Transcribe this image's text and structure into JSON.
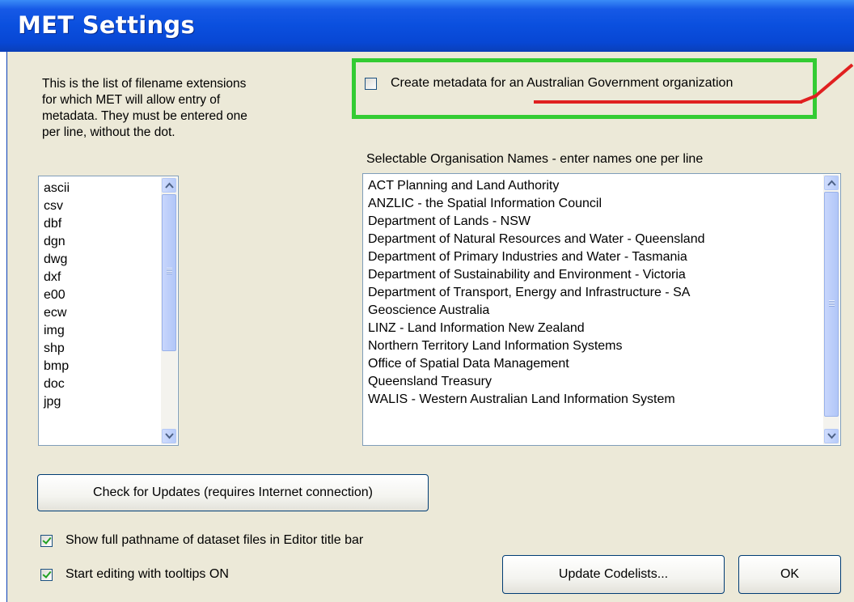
{
  "window": {
    "title": "MET Settings"
  },
  "extensions": {
    "description": "This is the list of filename extensions\nfor which MET will allow entry of\nmetadata.  They must be entered one\nper line, without the dot.",
    "items": [
      "ascii",
      "csv",
      "dbf",
      "dgn",
      "dwg",
      "dxf",
      "e00",
      "ecw",
      "img",
      "shp",
      "bmp",
      "doc",
      "jpg"
    ]
  },
  "australian_gov": {
    "label": "Create metadata for an Australian Government organization",
    "checked": false
  },
  "organisations": {
    "label": "Selectable Organisation Names - enter names one per line",
    "items": [
      "ACT Planning and Land Authority",
      "ANZLIC - the Spatial Information Council",
      "Department of Lands - NSW",
      "Department of Natural Resources and Water - Queensland",
      "Department of Primary Industries and Water - Tasmania",
      "Department of Sustainability and Environment - Victoria",
      "Department of Transport, Energy and Infrastructure - SA",
      "Geoscience Australia",
      "LINZ - Land Information New Zealand",
      "Northern Territory Land Information Systems",
      "Office of Spatial Data Management",
      "Queensland Treasury",
      "WALIS - Western Australian Land Information System"
    ]
  },
  "buttons": {
    "check_updates": "Check for Updates (requires Internet connection)",
    "update_codelists": "Update Codelists...",
    "ok": "OK"
  },
  "options": {
    "show_full_pathname": {
      "label": "Show full pathname of dataset files in Editor title bar",
      "checked": true
    },
    "tooltips_on": {
      "label": "Start editing with tooltips ON",
      "checked": true
    }
  },
  "colors": {
    "highlight_box": "#33cc33",
    "annotation_line": "#e02020",
    "titlebar": "#0a4fde"
  }
}
